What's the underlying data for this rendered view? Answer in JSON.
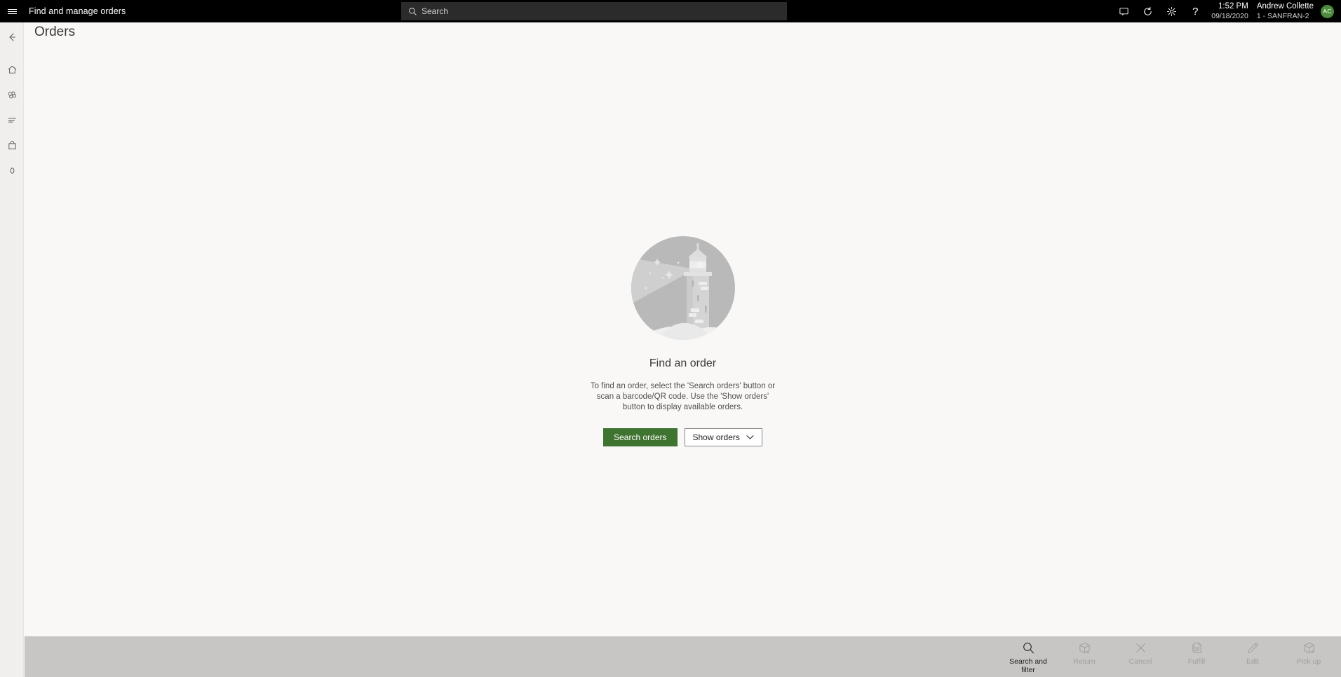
{
  "topbar": {
    "menu_icon": "hamburger-icon",
    "app_title": "Find and manage orders",
    "search": {
      "icon": "search-icon",
      "placeholder": "Search",
      "value": ""
    },
    "icons": [
      {
        "name": "screen-icon",
        "glyph": "display"
      },
      {
        "name": "refresh-icon",
        "glyph": "refresh"
      },
      {
        "name": "settings-gear-icon",
        "glyph": "gear"
      },
      {
        "name": "help-icon",
        "glyph": "?"
      }
    ],
    "clock": {
      "time": "1:52 PM",
      "date": "09/18/2020"
    },
    "user": {
      "name": "Andrew Collette",
      "store": "1 - SANFRAN-2",
      "initials": "AC"
    }
  },
  "rail": {
    "items": [
      {
        "name": "back-arrow-icon",
        "label": "Back"
      },
      {
        "name": "home-icon",
        "label": "Home"
      },
      {
        "name": "products-icon",
        "label": "Products"
      },
      {
        "name": "list-icon",
        "label": "Tasks"
      },
      {
        "name": "shopping-bag-icon",
        "label": "Cart"
      },
      {
        "name": "zero-amount-icon",
        "label": "0"
      }
    ]
  },
  "page": {
    "title": "Orders"
  },
  "empty_state": {
    "illustration": "lighthouse-illustration",
    "title": "Find an order",
    "body": "To find an order, select the 'Search orders' button or scan a barcode/QR code. Use the 'Show orders' button to display available orders.",
    "primary_button": "Search orders",
    "secondary_button": "Show orders",
    "secondary_chevron": "chevron-down-icon"
  },
  "command_bar": {
    "commands": [
      {
        "label": "Search and filter",
        "icon": "magnifier-icon",
        "enabled": true
      },
      {
        "label": "Return",
        "icon": "return-box-icon",
        "enabled": false
      },
      {
        "label": "Cancel",
        "icon": "close-x-icon",
        "enabled": false
      },
      {
        "label": "Fulfill",
        "icon": "document-icon",
        "enabled": false
      },
      {
        "label": "Edit",
        "icon": "pencil-icon",
        "enabled": false
      },
      {
        "label": "Pick up",
        "icon": "pickup-box-icon",
        "enabled": false
      }
    ]
  },
  "colors": {
    "topbar_bg": "#000000",
    "search_bg": "#2b2b2b",
    "rail_bg": "#f0efee",
    "page_bg": "#f9f8f7",
    "cmdbar_bg": "#c8c6c4",
    "primary_green": "#3f7430",
    "avatar_green": "#4b8b3b",
    "disabled_text": "#a19f9d"
  }
}
